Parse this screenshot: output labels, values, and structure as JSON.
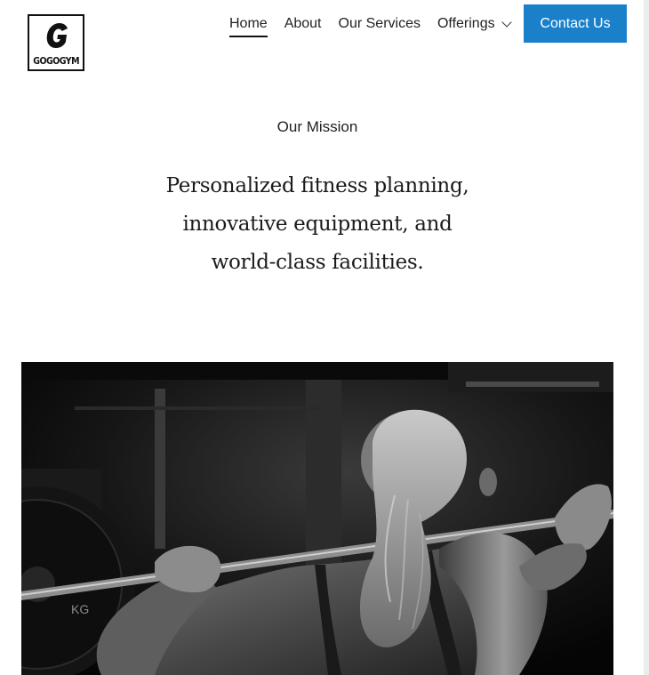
{
  "brand": {
    "logo_text": "GOGOGYM",
    "logo_icon": "g-letter-icon"
  },
  "nav": {
    "items": [
      {
        "label": "Home",
        "active": true
      },
      {
        "label": "About",
        "active": false
      },
      {
        "label": "Our Services",
        "active": false
      },
      {
        "label": "Offerings",
        "active": false,
        "has_dropdown": true
      }
    ],
    "cta_label": "Contact Us",
    "cta_color": "#1a80c9"
  },
  "mission": {
    "eyebrow": "Our Mission",
    "headline_lines": [
      "Personalized fitness planning,",
      "innovative equipment, and",
      "world-class facilities."
    ]
  },
  "hero_image": {
    "subject": "woman-lifting-barbell-photo",
    "plate_text": "KG"
  }
}
